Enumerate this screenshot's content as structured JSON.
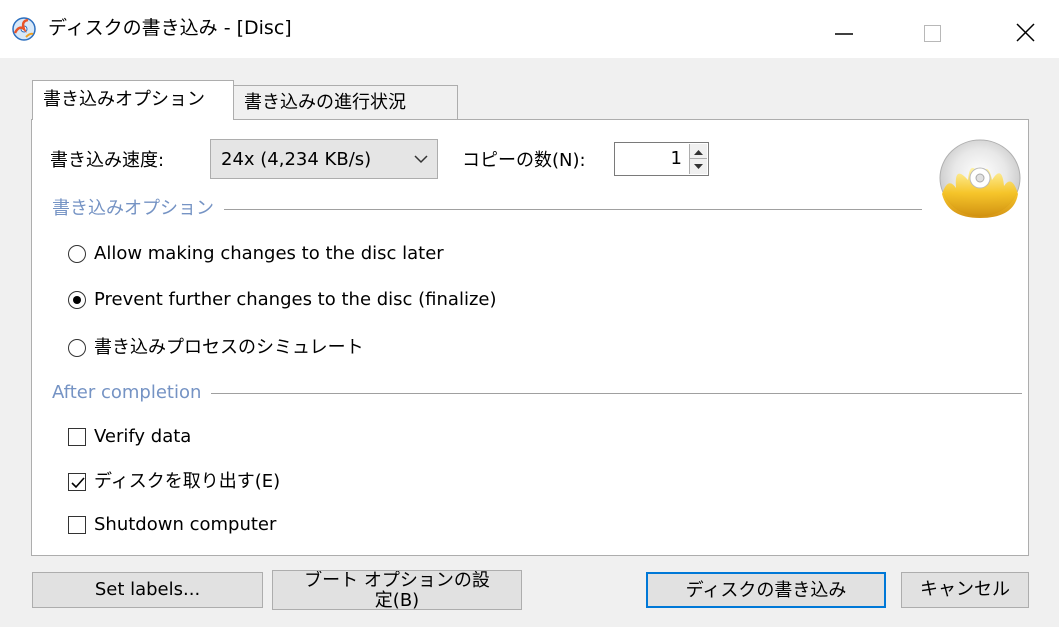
{
  "window": {
    "title": "ディスクの書き込み - [Disc]",
    "app_icon": "burn-disc-icon",
    "controls": [
      "minimize-icon",
      "maximize-icon",
      "close-icon"
    ]
  },
  "tabs": [
    {
      "label": "書き込みオプション",
      "active": true
    },
    {
      "label": "書き込みの進行状況",
      "active": false
    }
  ],
  "options": {
    "speed_label": "書き込み速度:",
    "speed_value": "24x (4,234 KB/s)",
    "copies_label": "コピーの数(N):",
    "copies_value": "1",
    "disc_icon": "burning-disc-icon"
  },
  "write_options_group": {
    "title": "書き込みオプション",
    "radios": [
      {
        "label": "Allow making changes to the disc later",
        "checked": false
      },
      {
        "label": "Prevent further changes to the disc (finalize)",
        "checked": true
      },
      {
        "label": "書き込みプロセスのシミュレート",
        "checked": false
      }
    ]
  },
  "after_group": {
    "title": "After completion",
    "checks": [
      {
        "label": "Verify data",
        "checked": false
      },
      {
        "label": "ディスクを取り出す(E)",
        "checked": true
      },
      {
        "label": "Shutdown computer",
        "checked": false
      }
    ]
  },
  "buttons": {
    "set_labels": "Set labels...",
    "boot_options": "ブート オプションの設定(B)",
    "burn": "ディスクの書き込み",
    "cancel": "キャンセル"
  },
  "colors": {
    "group_title": "#7593c4",
    "default_button_border": "#0078d7",
    "background": "#f0f0f0"
  }
}
